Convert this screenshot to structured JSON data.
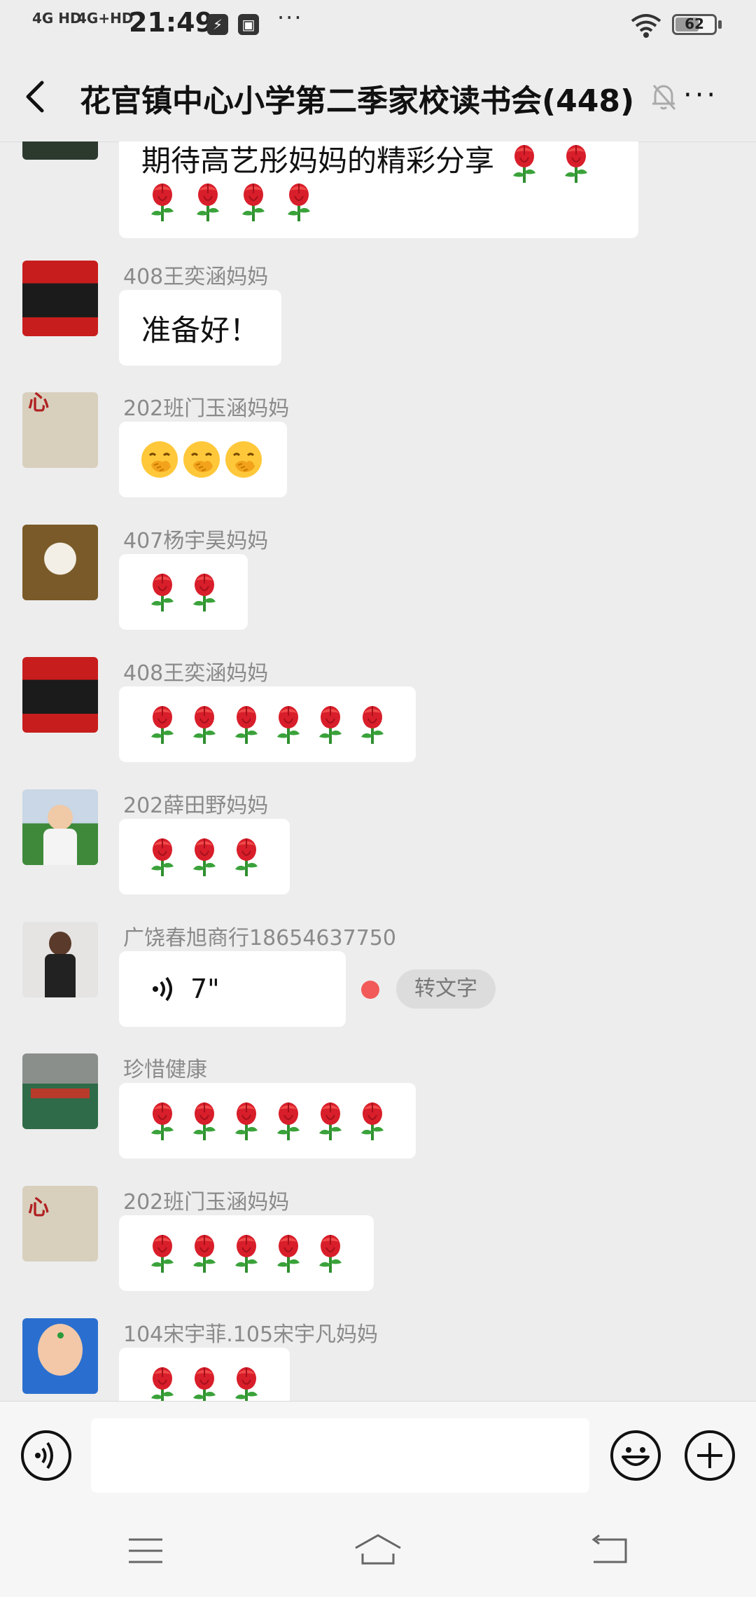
{
  "status_bar": {
    "network_1": "4G HD",
    "network_2": "4G+HD",
    "time": "21:49",
    "overflow": "···",
    "battery_level": "62",
    "battery_fraction": 0.62
  },
  "header": {
    "title": "花官镇中心小学第二季家校读书会(448)",
    "back_icon": "chevron-left-icon",
    "mute_icon": "bell-off-icon",
    "more": "···"
  },
  "messages": [
    {
      "type": "text_cont",
      "text": "期待高艺彤妈妈的精彩分享",
      "trailing_roses": 2,
      "second_line_roses": 4
    },
    {
      "type": "text",
      "sender": "408王奕涵妈妈",
      "text": "准备好！",
      "avatar": "red-flag-portrait"
    },
    {
      "type": "emoji",
      "sender": "202班门玉涵妈妈",
      "emoji_count": 3,
      "emoji": "grinning-hand-over-mouth",
      "avatar": "calligraphy-card",
      "avatar_text": "因为有你 心存感激"
    },
    {
      "type": "roses",
      "sender": "407杨宇昊妈妈",
      "rose_count": 2,
      "avatar": "lamb"
    },
    {
      "type": "roses",
      "sender": "408王奕涵妈妈",
      "rose_count": 6,
      "avatar": "red-flag-portrait"
    },
    {
      "type": "roses",
      "sender": "202薛田野妈妈",
      "rose_count": 3,
      "avatar": "child-outdoor"
    },
    {
      "type": "voice",
      "sender": "广饶春旭商行18654637750",
      "duration": "7\"",
      "convert_label": "转文字",
      "avatar": "woman-portrait"
    },
    {
      "type": "roses",
      "sender": "珍惜健康",
      "rose_count": 6,
      "avatar": "classroom"
    },
    {
      "type": "roses",
      "sender": "202班门玉涵妈妈",
      "rose_count": 5,
      "avatar": "calligraphy-card",
      "avatar_text": "因为有你 心存感激"
    },
    {
      "type": "roses",
      "sender": "104宋宇菲.105宋宇凡妈妈",
      "rose_count": 3,
      "avatar": "child-blue"
    }
  ],
  "input_bar": {
    "voice_icon": "voice-icon",
    "emoji_icon": "smiley-icon",
    "plus_icon": "plus-icon"
  },
  "nav_bar": {
    "menu_icon": "menu-icon",
    "home_icon": "home-icon",
    "back_icon": "return-icon"
  },
  "colors": {
    "background": "#ededed",
    "bubble": "#ffffff",
    "sender": "#8a8a8a",
    "unread_dot": "#f15a59"
  }
}
